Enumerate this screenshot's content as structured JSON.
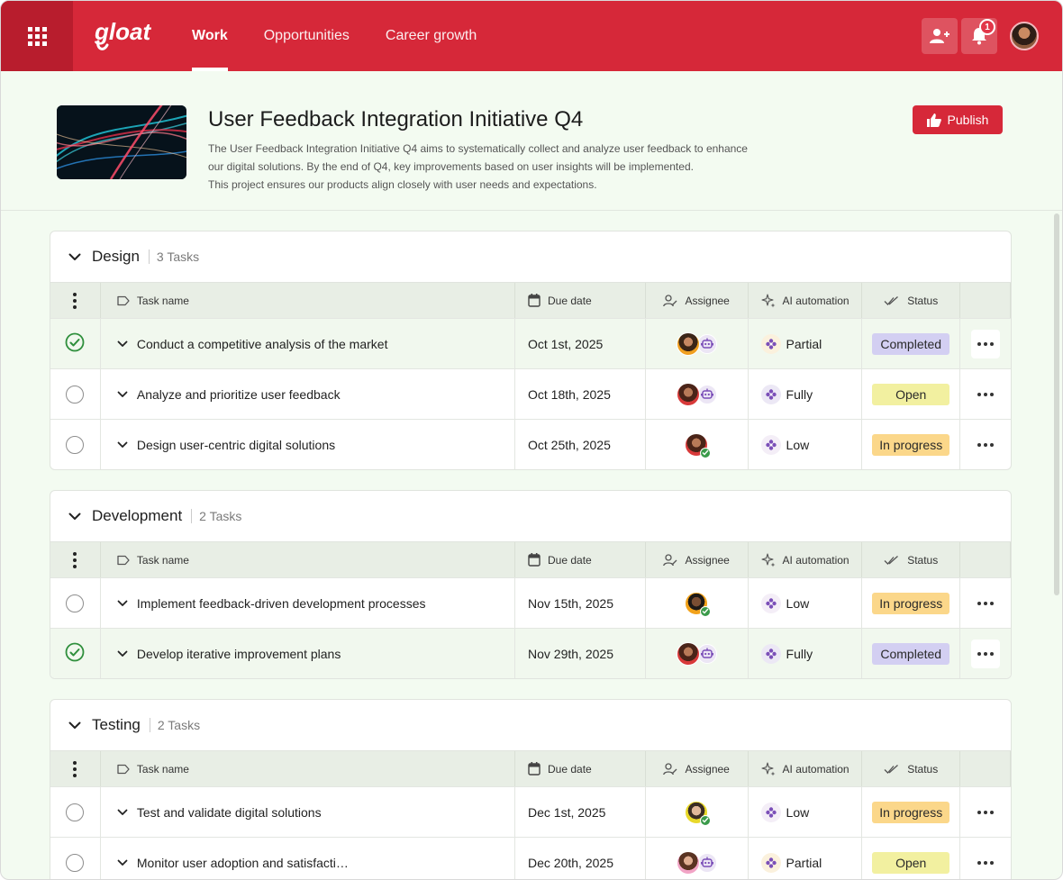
{
  "header": {
    "logo_text": "gloat",
    "nav": [
      {
        "label": "Work",
        "active": true
      },
      {
        "label": "Opportunities",
        "active": false
      },
      {
        "label": "Career growth",
        "active": false
      }
    ],
    "notification_count": "1"
  },
  "project": {
    "title": "User Feedback Integration Initiative Q4",
    "description_lines": [
      "The User Feedback Integration Initiative Q4 aims to systematically collect and analyze user feedback to enhance",
      "our digital solutions. By the end of Q4, key improvements based on user insights will be implemented.",
      "This project ensures our products align closely with user needs and expectations."
    ],
    "publish_label": "Publish"
  },
  "columns": {
    "task_name": "Task name",
    "due_date": "Due date",
    "assignee": "Assignee",
    "ai_automation": "AI automation",
    "status": "Status"
  },
  "status_colors": {
    "Completed": "#d3cff2",
    "Open": "#f2f0a0",
    "In progress": "#fbd78a"
  },
  "groups": [
    {
      "name": "Design",
      "count": "3 Tasks",
      "tasks": [
        {
          "name": "Conduct a competitive analysis of the market",
          "due": "Oct 1st, 2025",
          "done": true,
          "assignee": "woman-curly",
          "assignee_type": "bot",
          "ai": "Partial",
          "status": "Completed"
        },
        {
          "name": "Analyze and prioritize user feedback",
          "due": "Oct 18th, 2025",
          "done": false,
          "assignee": "woman-red",
          "assignee_type": "bot",
          "ai": "Fully",
          "status": "Open"
        },
        {
          "name": "Design user-centric digital solutions",
          "due": "Oct 25th, 2025",
          "done": false,
          "assignee": "woman-red",
          "assignee_type": "check",
          "ai": "Low",
          "status": "In progress"
        }
      ]
    },
    {
      "name": "Development",
      "count": "2 Tasks",
      "tasks": [
        {
          "name": "Implement feedback-driven development  processes",
          "due": "Nov 15th, 2025",
          "done": false,
          "assignee": "man-orange",
          "assignee_type": "check",
          "ai": "Low",
          "status": "In progress"
        },
        {
          "name": "Develop iterative improvement plans",
          "due": "Nov 29th, 2025",
          "done": true,
          "assignee": "woman-red",
          "assignee_type": "bot",
          "ai": "Fully",
          "status": "Completed"
        }
      ]
    },
    {
      "name": "Testing",
      "count": "2 Tasks",
      "tasks": [
        {
          "name": "Test and validate digital solutions",
          "due": "Dec 1st, 2025",
          "done": false,
          "assignee": "man-yellow",
          "assignee_type": "check",
          "ai": "Low",
          "status": "In progress"
        },
        {
          "name": "Monitor user adoption and satisfacti…",
          "due": "Dec 20th, 2025",
          "done": false,
          "assignee": "woman-pink",
          "assignee_type": "bot",
          "ai": "Partial",
          "status": "Open"
        }
      ]
    }
  ]
}
